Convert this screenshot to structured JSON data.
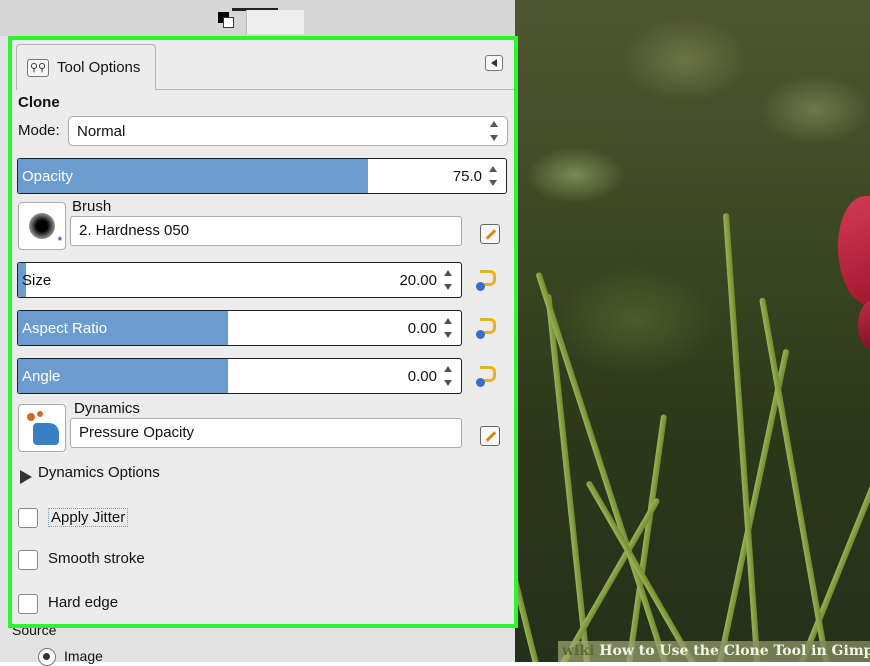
{
  "tab": {
    "label": "Tool Options",
    "icon": "tool-options-icon"
  },
  "tool_name": "Clone",
  "mode": {
    "label": "Mode:",
    "value": "Normal"
  },
  "opacity": {
    "label": "Opacity",
    "value": "75.0",
    "fraction": 0.75
  },
  "brush": {
    "caption": "Brush",
    "name": "2. Hardness 050"
  },
  "size": {
    "label": "Size",
    "value": "20.00",
    "fraction": 0.02
  },
  "aspect_ratio": {
    "label": "Aspect Ratio",
    "value": "0.00",
    "fraction": 0.5
  },
  "angle": {
    "label": "Angle",
    "value": "0.00",
    "fraction": 0.5
  },
  "dynamics": {
    "caption": "Dynamics",
    "name": "Pressure Opacity"
  },
  "dynamics_options": {
    "label": "Dynamics Options"
  },
  "apply_jitter": {
    "label": "Apply Jitter",
    "checked": false
  },
  "smooth_stroke": {
    "label": "Smooth stroke",
    "checked": false
  },
  "hard_edge": {
    "label": "Hard edge",
    "checked": false
  },
  "source": {
    "label": "Source",
    "option": "Image",
    "selected": true
  },
  "watermark": {
    "brand": "wiki",
    "text": "How to Use the Clone Tool in Gimp"
  },
  "colors": {
    "highlight": "#2ff52f",
    "slider_fill": "#6c9bcf",
    "reset_icon": "#e8b21a"
  }
}
